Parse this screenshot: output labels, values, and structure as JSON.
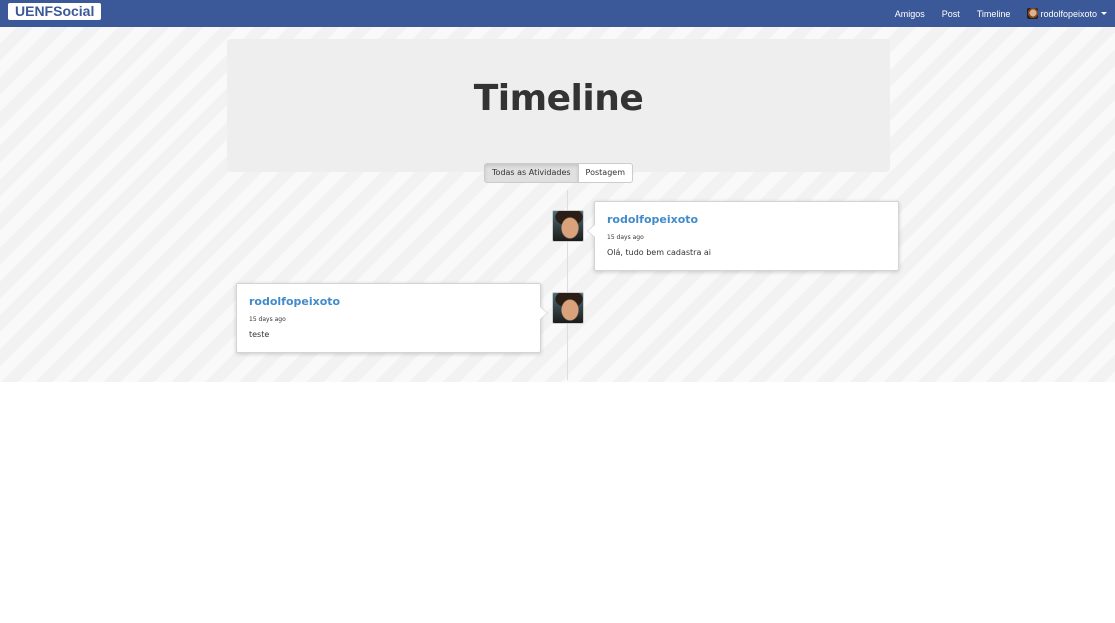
{
  "navbar": {
    "brand": "UENFSocial",
    "links": [
      "Amigos",
      "Post",
      "Timeline"
    ],
    "user": "rodolfopeixoto",
    "brand_color": "#3b5998"
  },
  "jumbotron": {
    "title": "Timeline",
    "buttons": [
      "Todas as Atividades",
      "Postagem"
    ],
    "active_button": "Todas as Atividades"
  },
  "timeline": {
    "posts": [
      {
        "user": "rodolfopeixoto",
        "time": "15 days ago",
        "text": "Olá, tudo bem cadastra ai",
        "side": "right"
      },
      {
        "user": "rodolfopeixoto",
        "time": "15 days ago",
        "text": "teste",
        "side": "left"
      }
    ]
  },
  "icons": {
    "user_avatar": "user-avatar-icon",
    "dropdown": "chevron-down-icon"
  }
}
